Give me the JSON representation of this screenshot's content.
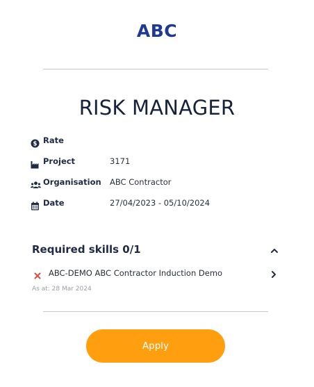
{
  "logo": {
    "text": "ABC",
    "color": "#1f3a93"
  },
  "page_title": "RISK MANAGER",
  "details": {
    "rate": {
      "label": "Rate",
      "value": "",
      "icon": "dollar-circle-icon"
    },
    "project": {
      "label": "Project",
      "value": "3171",
      "icon": "factory-icon"
    },
    "organisation": {
      "label": "Organisation",
      "value": "ABC Contractor",
      "icon": "users-icon"
    },
    "date": {
      "label": "Date",
      "value": "27/04/2023 - 05/10/2024",
      "icon": "calendar-icon"
    }
  },
  "skills": {
    "title": "Required skills 0/1",
    "expanded": true,
    "items": [
      {
        "name": "ABC-DEMO ABC Contractor Induction Demo",
        "status": "missing",
        "status_color": "#e0483e"
      }
    ],
    "as_at": "As at: 28 Mar 2024"
  },
  "apply_button": {
    "label": "Apply",
    "color": "#ff9f0f"
  }
}
